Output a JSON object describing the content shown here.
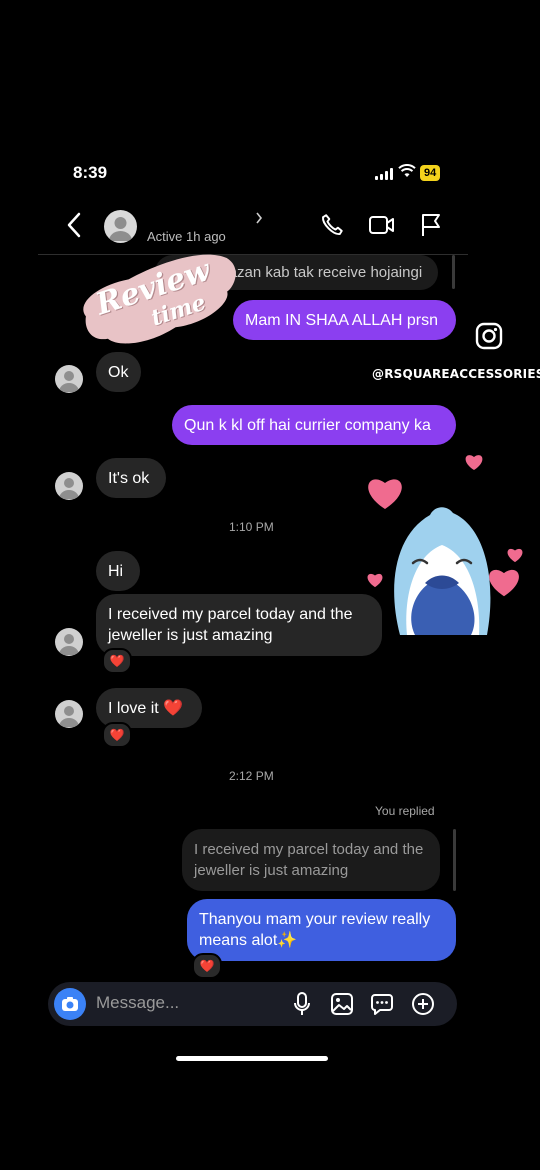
{
  "status": {
    "time": "8:39",
    "battery": "94"
  },
  "header": {
    "active_status": "Active 1h ago"
  },
  "overlay": {
    "sticker_line1": "Review",
    "sticker_line2": "time",
    "brand_handle": "@RSQUAREACCESSORIES"
  },
  "messages": {
    "partial_quote": "Mujhe ..dazan kab tak receive hojaingi",
    "out1": "Mam IN SHAA ALLAH prsn",
    "in_ok": "Ok",
    "out2": "Qun k kl off hai currier company ka",
    "in_itsok": "It's ok",
    "time1": "1:10 PM",
    "in_hi": "Hi",
    "in_received": "I received my parcel today and the jeweller is just amazing",
    "in_love": "I love it ❤️",
    "time2": "2:12 PM",
    "you_replied": "You replied",
    "quoted_reply": "I received my parcel today and the jeweller is just amazing",
    "out_reply": "Thanyou mam your review really means alot✨",
    "reaction": "❤️"
  },
  "composer": {
    "placeholder": "Message..."
  },
  "colors": {
    "outgoing": "#8b3ff0",
    "incoming": "#262626",
    "camera": "#3b82f6"
  }
}
